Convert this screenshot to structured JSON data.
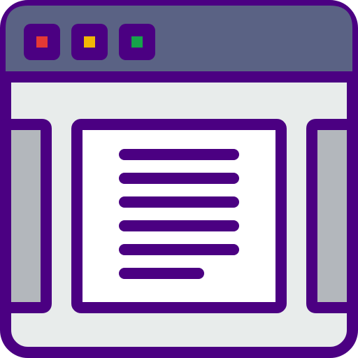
{
  "icon": {
    "name": "browser-window-document-carousel-icon",
    "colors": {
      "outline": "#4B0082",
      "title_bar": "#5A6284",
      "window_bg": "#E8ECEB",
      "side_panel": "#B3B7BC",
      "document_bg": "#FFFFFF",
      "text_lines": "#4B0082",
      "dot_red": "#E53935",
      "dot_yellow": "#F2B705",
      "dot_green": "#16A34A"
    }
  }
}
